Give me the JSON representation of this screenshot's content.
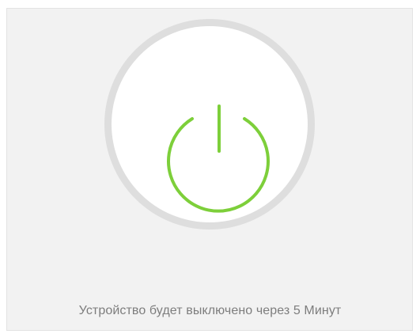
{
  "power_dialog": {
    "status_text": "Устройство будет выключено через  5 Минут",
    "icon": "power-icon",
    "colors": {
      "panel_background": "#f2f2f2",
      "ring": "#dedede",
      "button_face": "#ffffff",
      "accent_green": "#7dcf3a",
      "status_text": "#7d7d7d"
    }
  }
}
